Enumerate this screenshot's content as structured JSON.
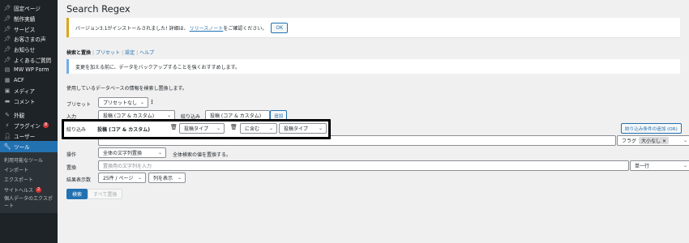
{
  "sidebar": {
    "items": [
      {
        "label": "固定ページ",
        "icon": "pin-icon"
      },
      {
        "label": "制作実績",
        "icon": "pin-icon"
      },
      {
        "label": "サービス",
        "icon": "pin-icon"
      },
      {
        "label": "お客さまの声",
        "icon": "pin-icon"
      },
      {
        "label": "お知らせ",
        "icon": "pin-icon"
      },
      {
        "label": "よくあるご質問",
        "icon": "pin-icon"
      },
      {
        "label": "MW WP Form",
        "icon": "form-icon"
      },
      {
        "label": "ACF",
        "icon": "grid-icon"
      },
      {
        "label": "メディア",
        "icon": "media-icon"
      },
      {
        "label": "コメント",
        "icon": "comment-icon"
      }
    ],
    "items2": [
      {
        "label": "外観",
        "icon": "brush-icon"
      },
      {
        "label": "プラグイン",
        "icon": "plugin-icon",
        "badge": "8"
      },
      {
        "label": "ユーザー",
        "icon": "user-icon"
      }
    ],
    "active": {
      "label": "ツール",
      "icon": "wrench-icon"
    },
    "submenu": [
      {
        "label": "利用可能なツール"
      },
      {
        "label": "インポート"
      },
      {
        "label": "エクスポート"
      },
      {
        "label": "サイトヘルス",
        "badge": "2"
      },
      {
        "label": "個人データのエクスポート"
      }
    ]
  },
  "page": {
    "title": "Search Regex",
    "notice": {
      "text": "バージョン3.1がインストールされました! 詳細は、",
      "link": "リリースノート",
      "suffix": "をご確認ください。",
      "ok": "OK"
    },
    "tabs": [
      "検索と置換",
      "プリセット",
      "設定",
      "ヘルプ"
    ],
    "info": "変更を加える前に、データをバックアップすることを強くおすすめします。",
    "description": "使用しているデータベースの情報を検索し置換します。"
  },
  "form": {
    "preset_label": "プリセット",
    "preset_value": "プリセットなし",
    "source_label": "入力",
    "source_value": "投稿 (コア & カスタム)",
    "filter_label_partial": "絞り込み",
    "filter_select_partial": "投稿 (コア & カスタム)",
    "filter_button_partial": "追加",
    "filter_row": {
      "label": "絞り込み",
      "source": "投稿 (コア & カスタム)",
      "column": "投稿タイプ",
      "logic": "に含む",
      "value": "投稿タイプ"
    },
    "add_filter_button": "絞り込み条件の追加 (OR)",
    "flags_label": "フラグ",
    "flag_tag": "大小なし",
    "action_label": "操作",
    "action_value": "全体の文字列置換",
    "action_hint": "全体検索の値を置換する。",
    "replace_label": "置換",
    "replace_placeholder": "置換用の文字列を入力",
    "replace_mode": "単一行",
    "results_label": "結果表示数",
    "per_page": "25件 / ページ",
    "columns": "列を表示",
    "search_button": "検索",
    "replace_all_button": "すべて置換"
  }
}
